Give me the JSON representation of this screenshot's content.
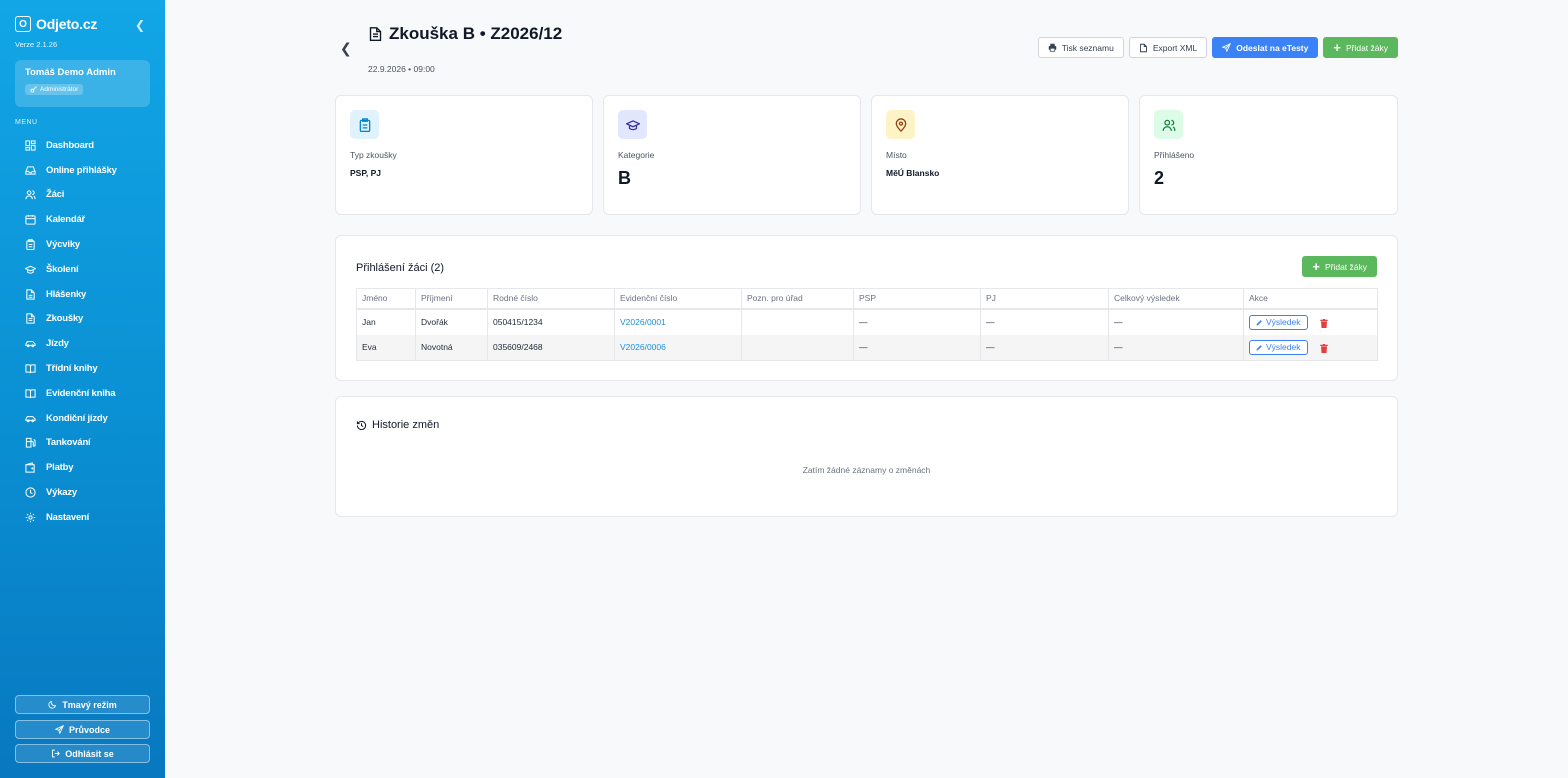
{
  "app": {
    "logo_letter": "O",
    "name": "Odjeto.cz",
    "version": "Verze 2.1.26"
  },
  "user": {
    "name": "Tomáš Demo Admin",
    "role": "Administrátor"
  },
  "sidebar": {
    "menu_title": "MENU",
    "items": [
      {
        "label": "Dashboard",
        "icon": "dashboard-icon"
      },
      {
        "label": "Online přihlášky",
        "icon": "inbox-icon"
      },
      {
        "label": "Žáci",
        "icon": "users-icon"
      },
      {
        "label": "Kalendář",
        "icon": "calendar-icon"
      },
      {
        "label": "Výcviky",
        "icon": "clipboard-icon"
      },
      {
        "label": "Školení",
        "icon": "graduation-cap-icon"
      },
      {
        "label": "Hlášenky",
        "icon": "file-icon"
      },
      {
        "label": "Zkoušky",
        "icon": "file-text-icon"
      },
      {
        "label": "Jízdy",
        "icon": "car-icon"
      },
      {
        "label": "Třídní knihy",
        "icon": "book-open-icon"
      },
      {
        "label": "Evidenční kniha",
        "icon": "book-icon"
      },
      {
        "label": "Kondiční jízdy",
        "icon": "car-icon"
      },
      {
        "label": "Tankování",
        "icon": "fuel-icon"
      },
      {
        "label": "Platby",
        "icon": "wallet-icon"
      },
      {
        "label": "Výkazy",
        "icon": "clock-icon"
      },
      {
        "label": "Nastavení",
        "icon": "gear-icon"
      }
    ],
    "dark_mode": "Tmavý režim",
    "guide": "Průvodce",
    "logout": "Odhlásit se"
  },
  "header": {
    "title": "Zkouška B • Z2026/12",
    "subtitle": "22.9.2026 • 09:00",
    "print": "Tisk seznamu",
    "export": "Export XML",
    "send": "Odeslat na eTesty",
    "add": "Přidat žáky"
  },
  "stats": {
    "type": {
      "label": "Typ zkoušky",
      "value": "PSP, PJ",
      "color": "#e0f2fe"
    },
    "category": {
      "label": "Kategorie",
      "value": "B",
      "color": "#e0e7ff"
    },
    "place": {
      "label": "Místo",
      "value": "MěÚ Blansko",
      "color": "#fef3c7"
    },
    "registered": {
      "label": "Přihlášeno",
      "value": "2",
      "color": "#dcfce7"
    }
  },
  "students": {
    "title": "Přihlášení žáci (2)",
    "add": "Přidat žáky",
    "columns": [
      "Jméno",
      "Příjmení",
      "Rodné číslo",
      "Evidenční číslo",
      "Pozn. pro úřad",
      "PSP",
      "PJ",
      "Celkový výsledek",
      "Akce"
    ],
    "rows": [
      {
        "first": "Jan",
        "last": "Dvořák",
        "rc": "050415/1234",
        "ev": "V2026/0001",
        "note": "",
        "psp": "—",
        "pj": "—",
        "total": "—",
        "action": "Výsledek"
      },
      {
        "first": "Eva",
        "last": "Novotná",
        "rc": "035609/2468",
        "ev": "V2026/0006",
        "note": "",
        "psp": "—",
        "pj": "—",
        "total": "—",
        "action": "Výsledek"
      }
    ]
  },
  "history": {
    "title": "Historie změn",
    "empty": "Zatím žádné záznamy o změnách"
  }
}
